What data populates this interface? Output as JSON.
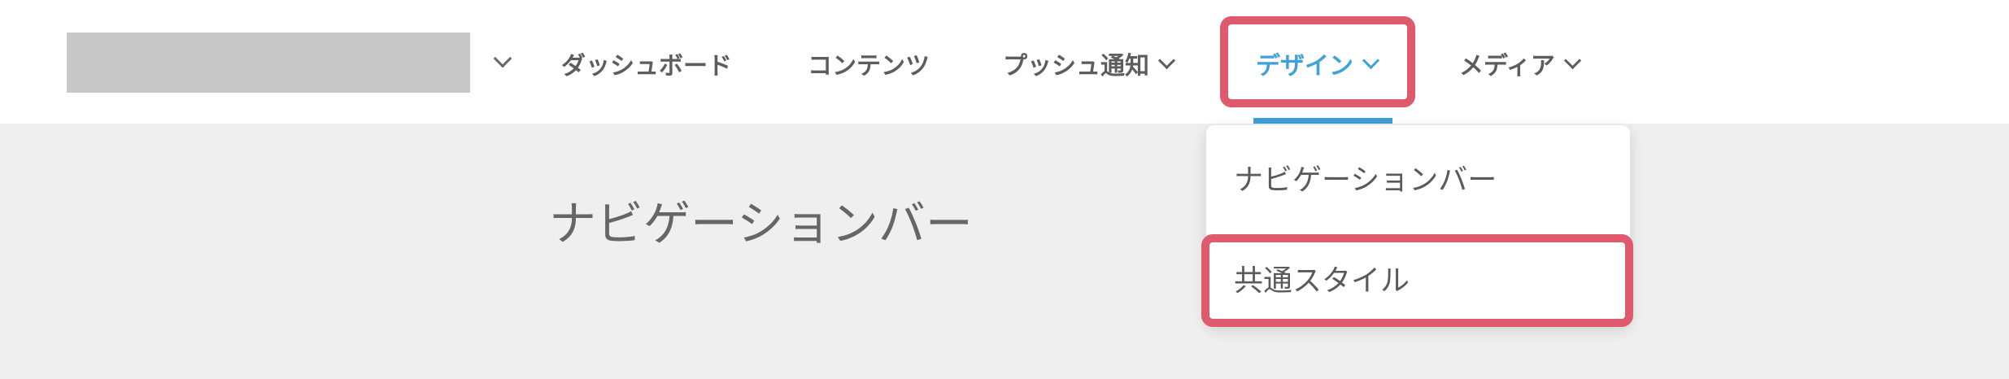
{
  "header": {
    "nav": {
      "dashboard": "ダッシュボード",
      "contents": "コンテンツ",
      "push": "プッシュ通知",
      "design": "デザイン",
      "media": "メディア"
    }
  },
  "dropdown": {
    "items": [
      "ナビゲーションバー",
      "共通スタイル"
    ]
  },
  "main": {
    "heading": "ナビゲーションバー"
  },
  "colors": {
    "accent": "#3ea2d8",
    "highlight": "#e05a6e",
    "header_bg": "#ffffff",
    "page_bg": "#efefef"
  },
  "icons": {
    "nav_dropdown": "chevron-down-icon"
  }
}
